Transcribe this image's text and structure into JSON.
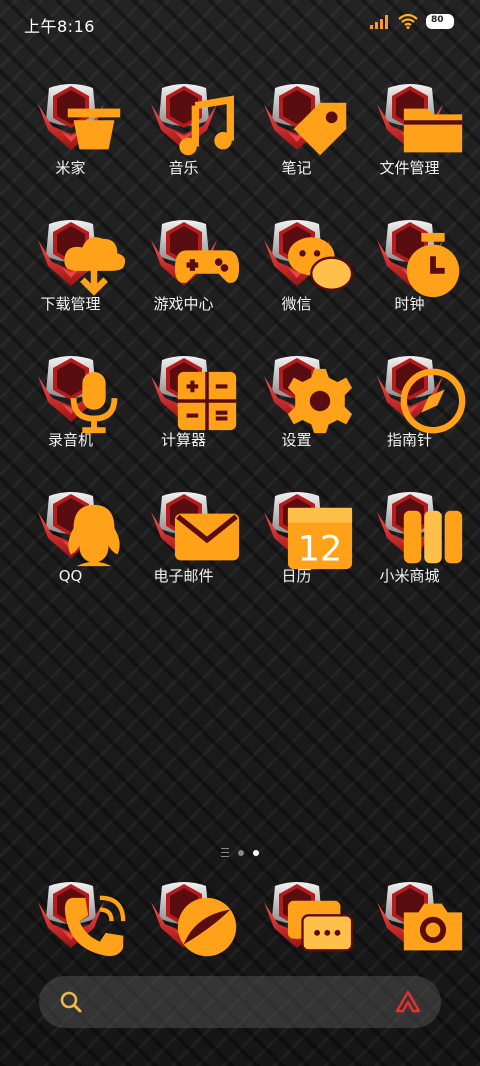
{
  "status": {
    "time": "上午8:16",
    "battery": "80"
  },
  "apps": [
    {
      "label": "米家",
      "icon": "mijia-icon"
    },
    {
      "label": "音乐",
      "icon": "music-icon"
    },
    {
      "label": "笔记",
      "icon": "notes-icon"
    },
    {
      "label": "文件管理",
      "icon": "folder-icon"
    },
    {
      "label": "下载管理",
      "icon": "download-icon"
    },
    {
      "label": "游戏中心",
      "icon": "gamepad-icon"
    },
    {
      "label": "微信",
      "icon": "wechat-icon"
    },
    {
      "label": "时钟",
      "icon": "clock-icon"
    },
    {
      "label": "录音机",
      "icon": "microphone-icon"
    },
    {
      "label": "计算器",
      "icon": "calculator-icon"
    },
    {
      "label": "设置",
      "icon": "gear-icon"
    },
    {
      "label": "指南针",
      "icon": "compass-icon"
    },
    {
      "label": "QQ",
      "icon": "qq-icon"
    },
    {
      "label": "电子邮件",
      "icon": "mail-icon"
    },
    {
      "label": "日历",
      "icon": "calendar-icon",
      "calendar_day": "12"
    },
    {
      "label": "小米商城",
      "icon": "store-icon"
    }
  ],
  "dock": [
    {
      "icon": "phone-icon"
    },
    {
      "icon": "browser-icon"
    },
    {
      "icon": "messages-icon"
    },
    {
      "icon": "camera-icon"
    }
  ],
  "colors": {
    "shield_red": "#d42d2d",
    "shield_silver": "#cfcfcf",
    "glyph_orange": "#ffa21a",
    "inner_dark": "#5a0d10"
  }
}
